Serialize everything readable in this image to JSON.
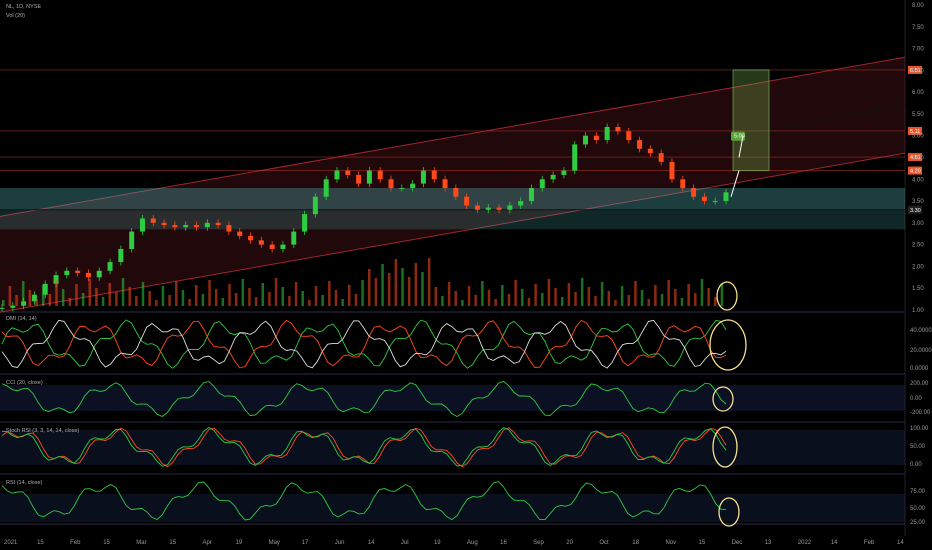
{
  "header": {
    "symbol_line": "NL, 1D, NYSE",
    "volume_label": "Vol (20)"
  },
  "colors": {
    "bg": "#000000",
    "up": "#2ecc40",
    "down": "#ff4a1c",
    "channel": "#ff3b4a",
    "zone": "#4fb3b3",
    "target_box": "#7fbf5a",
    "ellipse": "#f5e08a",
    "grid": "#1a1a1a",
    "pane_border": "#2a2a4a"
  },
  "chart_data": [
    {
      "id": "price",
      "type": "candlestick",
      "title": "NL, 1D, NYSE",
      "y_ticks": [
        "8.00",
        "7.50",
        "7.00",
        "6.50",
        "6.00",
        "5.50",
        "5.00",
        "4.50",
        "4.00",
        "3.50",
        "3.00",
        "2.50",
        "2.00",
        "1.50",
        "1.00"
      ],
      "ylim": [
        1.0,
        8.0
      ],
      "price_tags": [
        {
          "text": "6.51",
          "value": 6.51,
          "color": "#e8542a"
        },
        {
          "text": "5.11",
          "value": 5.11,
          "color": "#e8542a"
        },
        {
          "text": "4.51",
          "value": 4.51,
          "color": "#e8542a"
        },
        {
          "text": "4.20",
          "value": 4.2,
          "color": "#e8542a"
        },
        {
          "text": "3.30",
          "value": 3.3,
          "color": "#222222"
        }
      ],
      "target_label": "5.00",
      "x_ticks": [
        "2021",
        "15",
        "Feb",
        "15",
        "Mar",
        "15",
        "Apr",
        "19",
        "May",
        "17",
        "Jun",
        "14",
        "Jul",
        "19",
        "Aug",
        "16",
        "Sep",
        "20",
        "Oct",
        "18",
        "Nov",
        "15",
        "Dec",
        "13",
        "2022",
        "14",
        "Feb",
        "14"
      ],
      "closes_approx": [
        1.05,
        1.1,
        1.2,
        1.35,
        1.6,
        1.8,
        1.9,
        1.85,
        1.75,
        1.9,
        2.1,
        2.4,
        2.8,
        3.1,
        3.0,
        2.95,
        2.9,
        2.95,
        2.9,
        3.0,
        2.95,
        2.8,
        2.7,
        2.6,
        2.5,
        2.4,
        2.5,
        2.8,
        3.2,
        3.6,
        4.0,
        4.2,
        4.1,
        3.9,
        4.2,
        4.0,
        3.8,
        3.8,
        3.9,
        4.2,
        4.0,
        3.8,
        3.6,
        3.4,
        3.3,
        3.35,
        3.3,
        3.4,
        3.5,
        3.8,
        4.0,
        4.1,
        4.2,
        4.8,
        5.0,
        4.9,
        5.2,
        5.1,
        4.9,
        4.7,
        4.6,
        4.4,
        4.0,
        3.8,
        3.6,
        3.5,
        3.5,
        3.7
      ]
    },
    {
      "id": "volume",
      "type": "bar",
      "title": "Vol (20)"
    },
    {
      "id": "dmi",
      "type": "line",
      "title": "DMI (14, 14)",
      "y_ticks": [
        "40.0000",
        "20.0000",
        "0.0000"
      ],
      "ylim": [
        -5,
        48
      ]
    },
    {
      "id": "cci",
      "type": "line",
      "title": "CCI (20, close)",
      "y_ticks": [
        "200.00",
        "0.00",
        "-200.00"
      ],
      "ylim": [
        -300,
        300
      ]
    },
    {
      "id": "stoch",
      "type": "line",
      "title": "Stoch RSI (3, 3, 14, 14, close)",
      "y_ticks": [
        "100.00",
        "50.00",
        "0.00"
      ],
      "ylim": [
        -10,
        110
      ]
    },
    {
      "id": "rsi",
      "type": "line",
      "title": "RSI (14, close)",
      "y_ticks": [
        "75.00",
        "50.00",
        "25.00"
      ],
      "ylim": [
        15,
        85
      ]
    }
  ]
}
